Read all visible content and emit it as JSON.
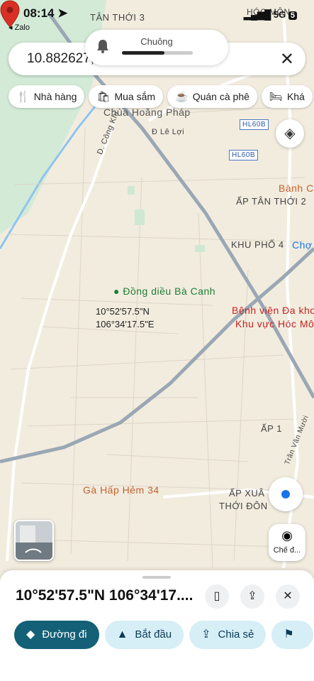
{
  "status": {
    "time": "08:14",
    "back_app": "◂ Zalo",
    "network": "5G",
    "battery": "5"
  },
  "notification": {
    "title": "Chuông",
    "volume_level": 0.6
  },
  "search": {
    "value": "10.882627,",
    "close_icon": "close-icon"
  },
  "chips": [
    {
      "label": "Nhà hàng",
      "icon": "restaurant-icon"
    },
    {
      "label": "Mua sắm",
      "icon": "shopping-bag-icon"
    },
    {
      "label": "Quán cà phê",
      "icon": "coffee-icon"
    },
    {
      "label": "Khá",
      "icon": "hotel-icon"
    }
  ],
  "map_labels": {
    "tan_thoi_3": "TÂN THỚI 3",
    "hoc_mon": "HÓC MÔN",
    "chua_hoang_phap": "Chùa Hoằng Pháp",
    "d_le_loi": "Đ Lê Lợi",
    "d_cong_khi": "D. Công Khi",
    "hl60b_1": "HL60B",
    "hl60b_2": "HL60B",
    "banh_ca": "Bành Ca",
    "ap_tan_thoi_2": "ẤP TÂN THỚI 2",
    "khu_pho_4": "KHU PHỐ 4",
    "cho": "Chợ",
    "dong_dieu": "Đồng diều Bà Canh",
    "benh_vien_1": "Bệnh viện Đa khoa",
    "benh_vien_2": "Khu vực Hóc Môn",
    "ap_1": "ẤP 1",
    "tran_van_muoi": "Trần Văn Mười",
    "ga_hap": "Gà Hấp Hẻm 34",
    "ap_xuan_1": "ẤP XUÂ",
    "ap_xuan_2": "THỚI ĐÔN"
  },
  "pin": {
    "lat": "10°52'57.5\"N",
    "lng": "106°34'17.5\"E"
  },
  "lens_button": {
    "label": "Chế đ..."
  },
  "sheet": {
    "title": "10°52'57.5\"N 106°34'17....",
    "actions": [
      {
        "label": "Đường đi",
        "icon": "directions-icon"
      },
      {
        "label": "Bắt đầu",
        "icon": "navigate-arrow-icon"
      },
      {
        "label": "Chia sẻ",
        "icon": "share-icon"
      },
      {
        "label": "",
        "icon": "flag-icon"
      }
    ]
  },
  "colors": {
    "accent": "#146077",
    "chip_bg": "#d6eef6",
    "pin": "#d93025",
    "map_bg": "#f2ecdf"
  }
}
